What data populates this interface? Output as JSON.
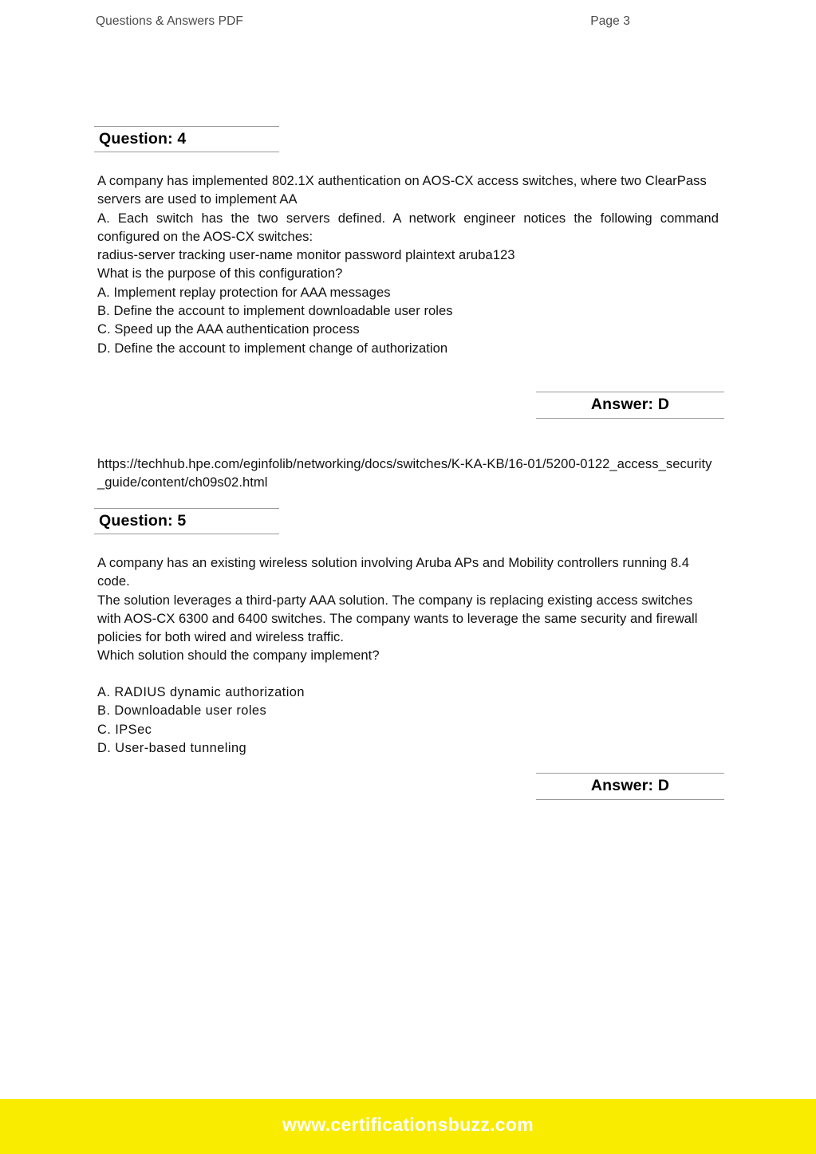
{
  "header": {
    "left_label": "Questions & Answers PDF",
    "right_label": "Page 3"
  },
  "questions": [
    {
      "label": "Question: 4",
      "lines": [
        "A company has implemented 802.1X authentication on AOS-CX access switches, where two ClearPass",
        "servers are used to implement AA",
        "A. Each switch has the two servers defined. A network engineer notices the following command configured on the AOS-CX switches:",
        "radius-server tracking user-name monitor password plaintext aruba123",
        "What is the purpose of this configuration?",
        "A. Implement replay protection for AAA messages",
        "B. Define the account to implement downloadable user roles",
        "C. Speed up the AAA authentication process",
        "D. Define the account to implement change of authorization"
      ],
      "answer_label": "Answer: D",
      "reference": "https://techhub.hpe.com/eginfolib/networking/docs/switches/K-KA-KB/16-01/5200-0122_access_security_guide/content/ch09s02.html"
    },
    {
      "label": "Question: 5",
      "lines": [
        "A company has an existing wireless solution involving Aruba APs and Mobility controllers running 8.4 code.",
        "The solution leverages a third-party AAA solution. The company is replacing existing access switches with AOS-CX 6300 and 6400 switches. The company wants to leverage the same security and firewall policies for both wired and wireless traffic.",
        "Which solution should the company implement?"
      ],
      "options": [
        "A. RADIUS dynamic authorization",
        "B. Downloadable user roles",
        "C. IPSec",
        "D. User-based tunneling"
      ],
      "answer_label": "Answer: D"
    }
  ],
  "footer": {
    "website": "www.certificationsbuzz.com",
    "background_color": "#f9ec00",
    "text_color": "#ffffff"
  }
}
